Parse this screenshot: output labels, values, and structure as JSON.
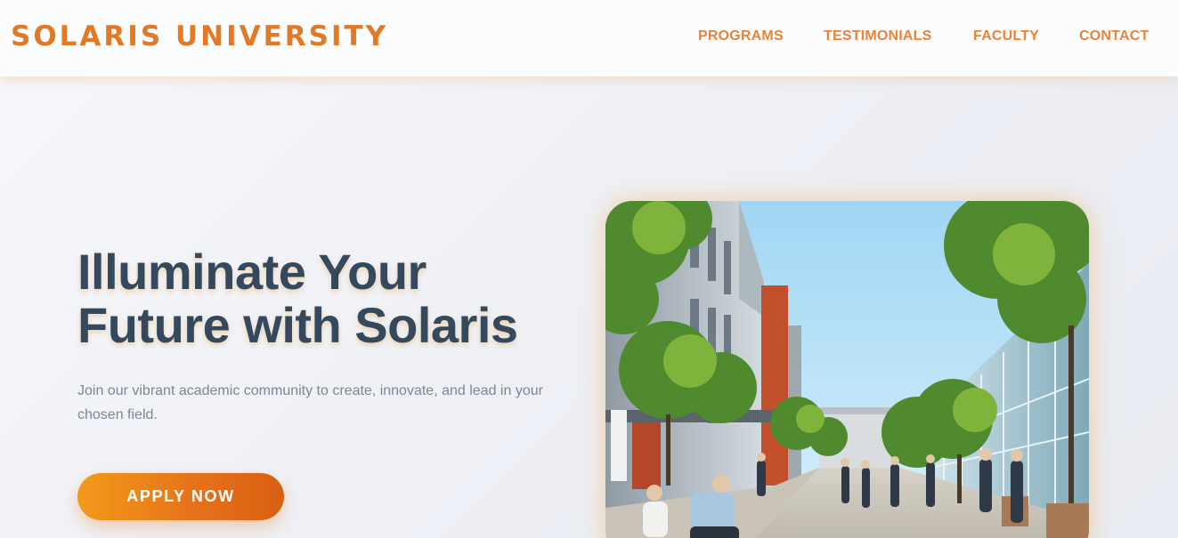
{
  "header": {
    "brand": "SOLARIS UNIVERSITY",
    "nav": [
      {
        "label": "PROGRAMS"
      },
      {
        "label": "TESTIMONIALS"
      },
      {
        "label": "FACULTY"
      },
      {
        "label": "CONTACT"
      }
    ]
  },
  "hero": {
    "title_line1": "Illuminate Your",
    "title_line2": "Future with Solaris",
    "subtitle": "Join our vibrant academic community to create, innovate, and lead in your chosen field.",
    "cta_label": "APPLY NOW"
  },
  "colors": {
    "brand_orange": "#e07a26",
    "nav_orange": "#e8843a",
    "heading": "#34495e",
    "body_text": "#7d8790",
    "button_start": "#f29a1a",
    "button_end": "#d95f12"
  }
}
